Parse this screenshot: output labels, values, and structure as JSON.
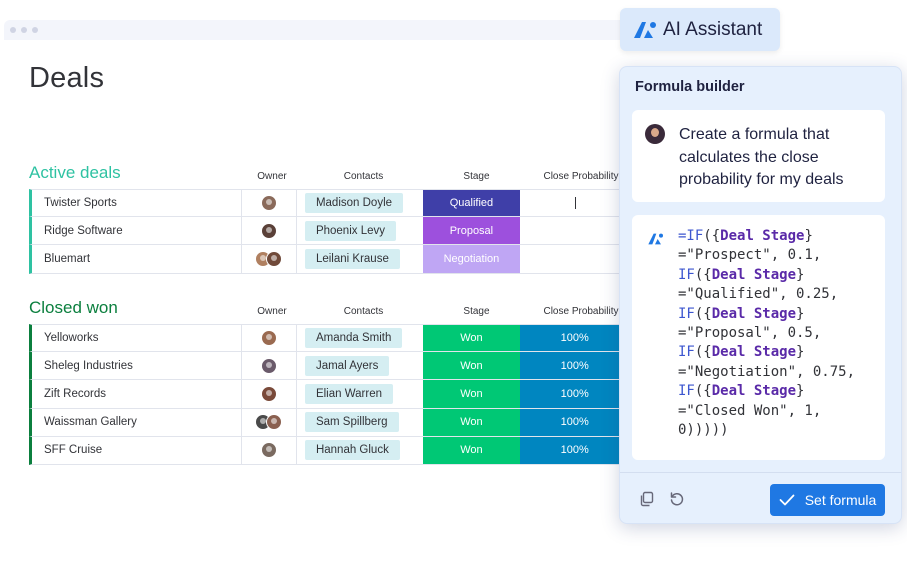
{
  "page": {
    "title": "Deals"
  },
  "groups": [
    {
      "title": "Active deals",
      "color": "#2ec2a2",
      "columns": {
        "owner": "Owner",
        "contacts": "Contacts",
        "stage": "Stage",
        "probability": "Close Probability"
      },
      "rows": [
        {
          "name": "Twister Sports",
          "owners": [
            "#8a6a5a"
          ],
          "contact": "Madison Doyle",
          "stage": "Qualified",
          "stage_color": "#3f3fa8",
          "probability": ""
        },
        {
          "name": "Ridge Software",
          "owners": [
            "#5a4038"
          ],
          "contact": "Phoenix Levy",
          "stage": "Proposal",
          "stage_color": "#9d50dd",
          "probability": ""
        },
        {
          "name": "Bluemart",
          "owners": [
            "#b08060",
            "#704a3a"
          ],
          "contact": "Leilani Krause",
          "stage": "Negotiation",
          "stage_color": "#bfa6f4",
          "probability": ""
        }
      ]
    },
    {
      "title": "Closed won",
      "color": "#0b7f3e",
      "columns": {
        "owner": "Owner",
        "contacts": "Contacts",
        "stage": "Stage",
        "probability": "Close Probability"
      },
      "rows": [
        {
          "name": "Yelloworks",
          "owners": [
            "#9a6a50"
          ],
          "contact": "Amanda Smith",
          "stage": "Won",
          "stage_color": "#00c875",
          "probability": "100%"
        },
        {
          "name": "Sheleg Industries",
          "owners": [
            "#6a5a6a"
          ],
          "contact": "Jamal Ayers",
          "stage": "Won",
          "stage_color": "#00c875",
          "probability": "100%"
        },
        {
          "name": "Zift Records",
          "owners": [
            "#7a4a3a"
          ],
          "contact": "Elian Warren",
          "stage": "Won",
          "stage_color": "#00c875",
          "probability": "100%"
        },
        {
          "name": "Waissman Gallery",
          "owners": [
            "#4a4a4a",
            "#8a6050"
          ],
          "contact": "Sam Spillberg",
          "stage": "Won",
          "stage_color": "#00c875",
          "probability": "100%"
        },
        {
          "name": "SFF Cruise",
          "owners": [
            "#7a6a60"
          ],
          "contact": "Hannah Gluck",
          "stage": "Won",
          "stage_color": "#00c875",
          "probability": "100%"
        }
      ]
    }
  ],
  "ai_tag": {
    "label": "AI Assistant",
    "icon": "ai-assistant-logo-icon"
  },
  "panel": {
    "title": "Formula builder",
    "prompt": "Create a formula that calculates the close probability for my deals",
    "formula_lines": [
      [
        [
          "kw",
          "=IF"
        ],
        [
          "str",
          "({"
        ],
        [
          "fld",
          "Deal Stage"
        ],
        [
          "str",
          "}"
        ]
      ],
      [
        [
          "str",
          "=\"Prospect\", 0.1,"
        ]
      ],
      [
        [
          "kw",
          "IF"
        ],
        [
          "str",
          "({"
        ],
        [
          "fld",
          "Deal Stage"
        ],
        [
          "str",
          "}"
        ]
      ],
      [
        [
          "str",
          "=\"Qualified\", 0.25,"
        ]
      ],
      [
        [
          "kw",
          "IF"
        ],
        [
          "str",
          "({"
        ],
        [
          "fld",
          "Deal Stage"
        ],
        [
          "str",
          "}"
        ]
      ],
      [
        [
          "str",
          "=\"Proposal\", 0.5,"
        ]
      ],
      [
        [
          "kw",
          "IF"
        ],
        [
          "str",
          "({"
        ],
        [
          "fld",
          "Deal Stage"
        ],
        [
          "str",
          "}"
        ]
      ],
      [
        [
          "str",
          "=\"Negotiation\", 0.75,"
        ]
      ],
      [
        [
          "kw",
          "IF"
        ],
        [
          "str",
          "({"
        ],
        [
          "fld",
          "Deal Stage"
        ],
        [
          "str",
          "}"
        ]
      ],
      [
        [
          "str",
          "=\"Closed Won\", 1,"
        ]
      ],
      [
        [
          "str",
          "0)))))"
        ]
      ]
    ],
    "copy_icon": "copy-icon",
    "regenerate_icon": "regenerate-icon",
    "set_formula_label": "Set formula",
    "accent": "#1f78e3",
    "prob_color": "#0086c0"
  }
}
